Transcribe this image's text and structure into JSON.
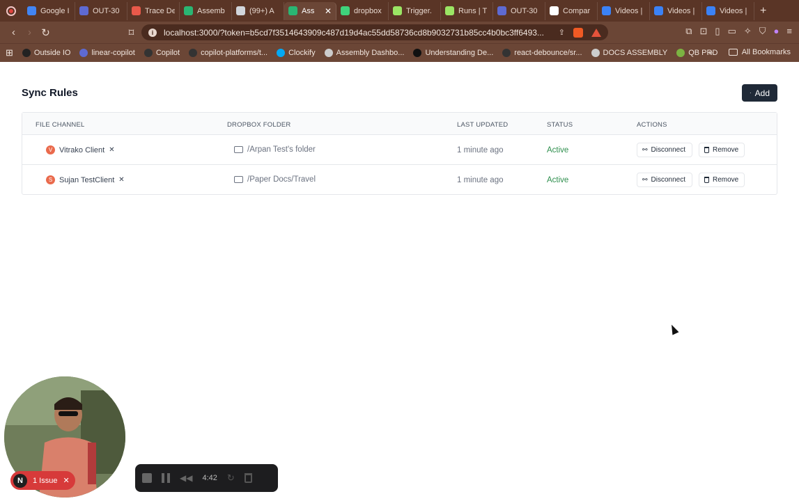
{
  "browser": {
    "tabs": [
      {
        "label": "Google I",
        "color": "#4285f4"
      },
      {
        "label": "OUT-30",
        "color": "#5e6ad2"
      },
      {
        "label": "Trace De",
        "color": "#e8594a"
      },
      {
        "label": "Assemb",
        "color": "#2ab673"
      },
      {
        "label": "(99+) A",
        "color": "#d1d5db"
      },
      {
        "label": "Ass",
        "color": "#2ab673",
        "active": true
      },
      {
        "label": "dropbox",
        "color": "#3fd27b"
      },
      {
        "label": "Trigger.",
        "color": "#9be564"
      },
      {
        "label": "Runs | T",
        "color": "#9be564"
      },
      {
        "label": "OUT-30",
        "color": "#5e6ad2"
      },
      {
        "label": "Compar",
        "color": "#ffffff"
      },
      {
        "label": "Videos |",
        "color": "#3b82f6"
      },
      {
        "label": "Videos |",
        "color": "#3b82f6"
      },
      {
        "label": "Videos |",
        "color": "#3b82f6"
      }
    ],
    "url": "localhost:3000/?token=b5cd7f3514643909c487d19d4ac55dd58736cd8b9032731b85cc4b0bc3ff6493...",
    "bookmarks": [
      {
        "label": "Outside IO",
        "color": "#222222"
      },
      {
        "label": "linear-copilot",
        "color": "#5e6ad2"
      },
      {
        "label": "Copilot",
        "color": "#333333"
      },
      {
        "label": "copilot-platforms/t...",
        "color": "#333333"
      },
      {
        "label": "Clockify",
        "color": "#03a9f4"
      },
      {
        "label": "Assembly Dashbo...",
        "color": "#cccccc"
      },
      {
        "label": "Understanding De...",
        "color": "#111111"
      },
      {
        "label": "react-debounce/sr...",
        "color": "#333333"
      },
      {
        "label": "DOCS ASSEMBLY",
        "color": "#cccccc"
      },
      {
        "label": "QB PRD",
        "color": "#7cb342"
      }
    ],
    "all_bookmarks": "All Bookmarks"
  },
  "page": {
    "title": "Sync Rules",
    "add_label": "Add"
  },
  "table": {
    "headers": {
      "file_channel": "FILE CHANNEL",
      "dropbox_folder": "DROPBOX FOLDER",
      "last_updated": "LAST UPDATED",
      "status": "STATUS",
      "actions": "ACTIONS"
    },
    "rows": [
      {
        "initial": "V",
        "channel": "Vitrako Client",
        "folder": "/Arpan Test's folder",
        "updated": "1 minute ago",
        "status": "Active",
        "disconnect": "Disconnect",
        "remove": "Remove"
      },
      {
        "initial": "S",
        "channel": "Sujan TestClient",
        "folder": "/Paper Docs/Travel",
        "updated": "1 minute ago",
        "status": "Active",
        "disconnect": "Disconnect",
        "remove": "Remove"
      }
    ]
  },
  "overlay": {
    "issue_badge": "N",
    "issue_label": "1 Issue",
    "recording_time": "4:42"
  }
}
